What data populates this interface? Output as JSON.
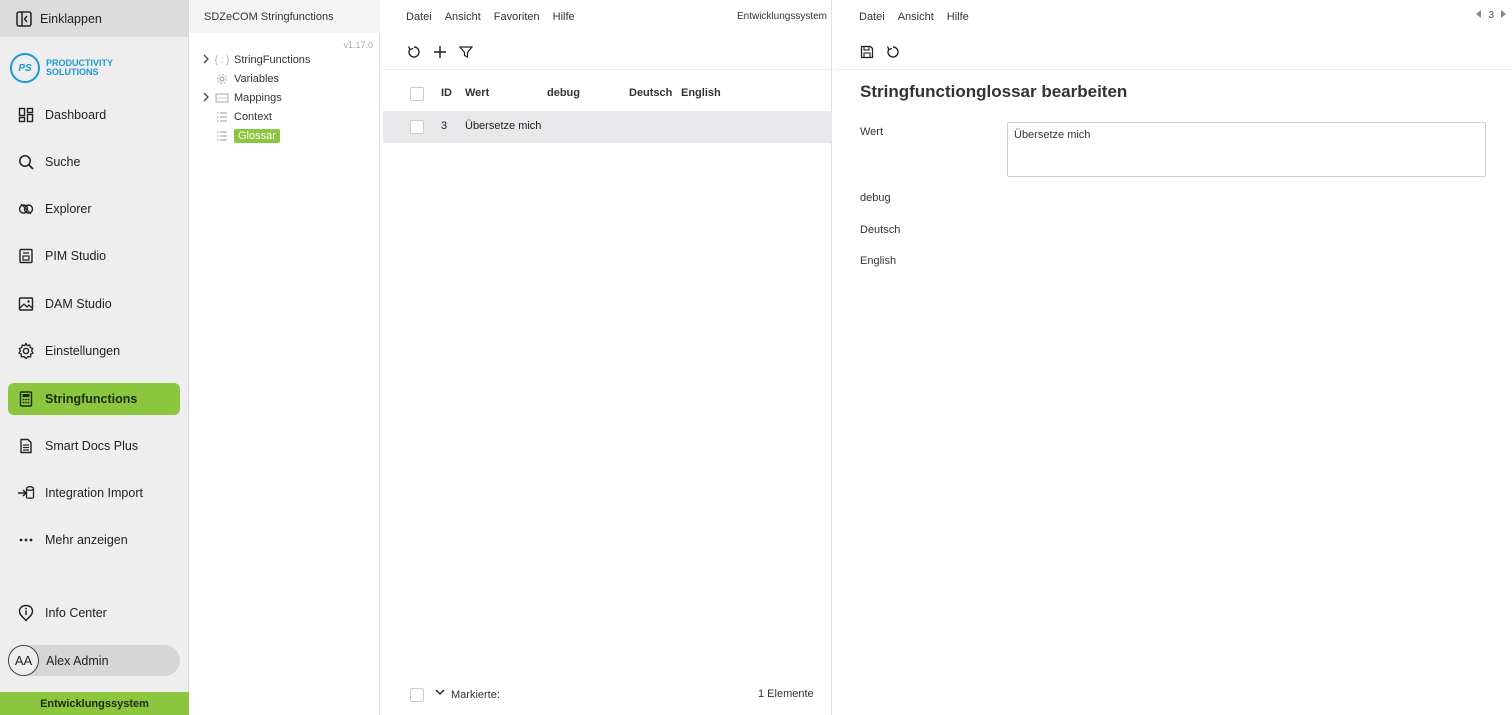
{
  "nav": {
    "collapse_label": "Einklappen",
    "logo_initials": "PS",
    "logo_text_line1": "PRODUCTIVITY",
    "logo_text_line2": "SOLUTIONS",
    "items": [
      {
        "label": "Dashboard",
        "icon": "dashboard-icon"
      },
      {
        "label": "Suche",
        "icon": "search-icon"
      },
      {
        "label": "Explorer",
        "icon": "explorer-icon"
      },
      {
        "label": "PIM Studio",
        "icon": "pim-icon"
      },
      {
        "label": "DAM Studio",
        "icon": "image-icon"
      },
      {
        "label": "Einstellungen",
        "icon": "gear-icon"
      },
      {
        "label": "Stringfunctions",
        "icon": "calculator-icon",
        "active": true
      },
      {
        "label": "Smart Docs Plus",
        "icon": "document-icon"
      },
      {
        "label": "Integration Import",
        "icon": "import-icon"
      },
      {
        "label": "Mehr anzeigen",
        "icon": "more-icon"
      }
    ],
    "info_center_label": "Info Center",
    "user": {
      "initials": "AA",
      "name": "Alex Admin"
    },
    "environment_label": "Entwicklungssystem"
  },
  "tree": {
    "title": "SDZeCOM Stringfunctions",
    "version": "v1.17.0",
    "items": [
      {
        "label": "StringFunctions",
        "expandable": true,
        "icon": "braces-icon"
      },
      {
        "label": "Variables",
        "expandable": false,
        "icon": "gear-icon"
      },
      {
        "label": "Mappings",
        "expandable": true,
        "icon": "mapping-icon"
      },
      {
        "label": "Context",
        "expandable": false,
        "icon": "list-icon"
      },
      {
        "label": "Glossar",
        "expandable": false,
        "icon": "list-icon",
        "selected": true
      }
    ]
  },
  "list": {
    "menu": [
      "Datei",
      "Ansicht",
      "Favoriten",
      "Hilfe"
    ],
    "environment_label": "Entwicklungssystem",
    "columns": [
      "ID",
      "Wert",
      "debug",
      "Deutsch",
      "English"
    ],
    "rows": [
      {
        "id": "3",
        "wert": "Übersetze mich",
        "debug": "",
        "deutsch": "",
        "english": ""
      }
    ],
    "footer_marked_label": "Markierte:",
    "footer_count": "1 Elemente"
  },
  "detail": {
    "menu": [
      "Datei",
      "Ansicht",
      "Hilfe"
    ],
    "pager_value": "3",
    "title": "Stringfunctionglossar bearbeiten",
    "fields": {
      "wert_label": "Wert",
      "wert_value": "Übersetze mich",
      "debug_label": "debug",
      "deutsch_label": "Deutsch",
      "english_label": "English"
    }
  },
  "colors": {
    "accent_green": "#8cc63f",
    "logo_blue": "#1a9ad6"
  }
}
